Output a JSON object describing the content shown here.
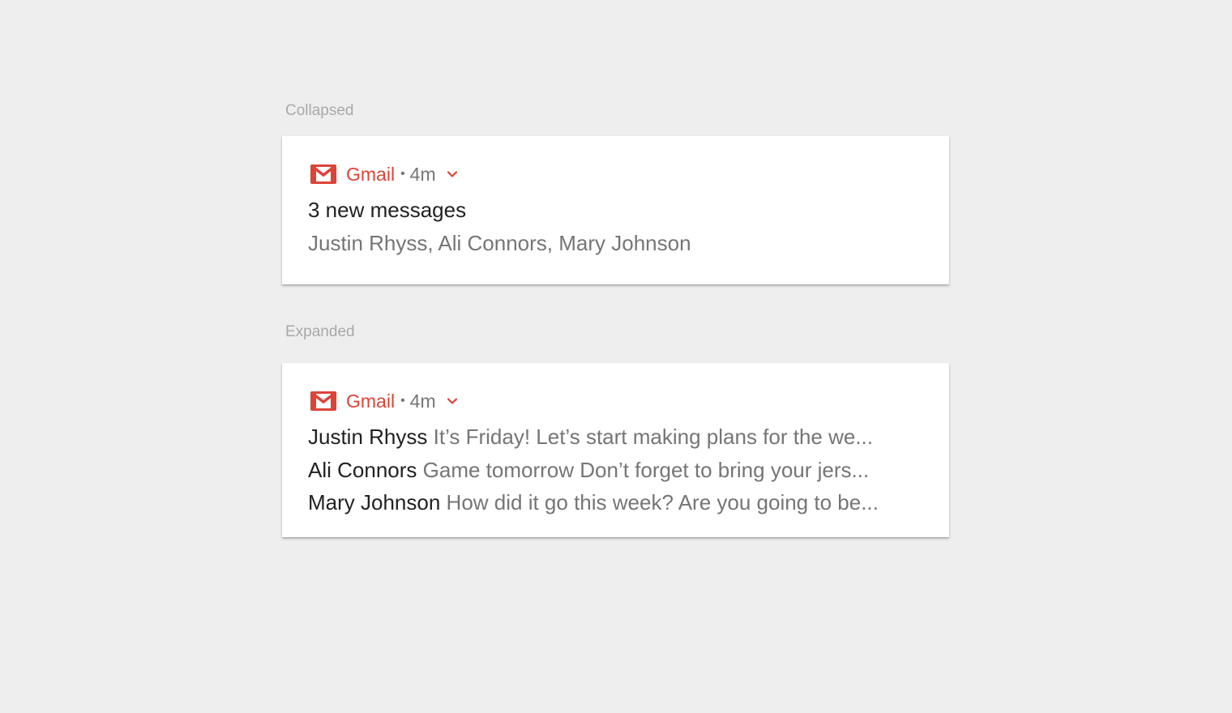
{
  "collapsed": {
    "section_label": "Collapsed",
    "notification": {
      "app_name": "Gmail",
      "separator": "•",
      "time": "4m",
      "title": "3 new messages",
      "subtitle": "Justin Rhyss, Ali Connors, Mary Johnson"
    }
  },
  "expanded": {
    "section_label": "Expanded",
    "notification": {
      "app_name": "Gmail",
      "separator": "•",
      "time": "4m",
      "messages": [
        {
          "sender": "Justin Rhyss",
          "preview": "It’s Friday! Let’s start making plans for the we..."
        },
        {
          "sender": "Ali Connors",
          "preview": "Game tomorrow Don’t forget to bring your jers..."
        },
        {
          "sender": "Mary Johnson",
          "preview": "How did it go this week? Are you going to be..."
        }
      ]
    }
  },
  "icons": {
    "app_icon": "gmail-icon",
    "expand_icon": "chevron-down-icon"
  },
  "colors": {
    "background": "#eeeeee",
    "card": "#ffffff",
    "accent": "#db4437",
    "primary_text": "#212121",
    "secondary_text": "#757575",
    "section_label": "#a9a9a9"
  }
}
